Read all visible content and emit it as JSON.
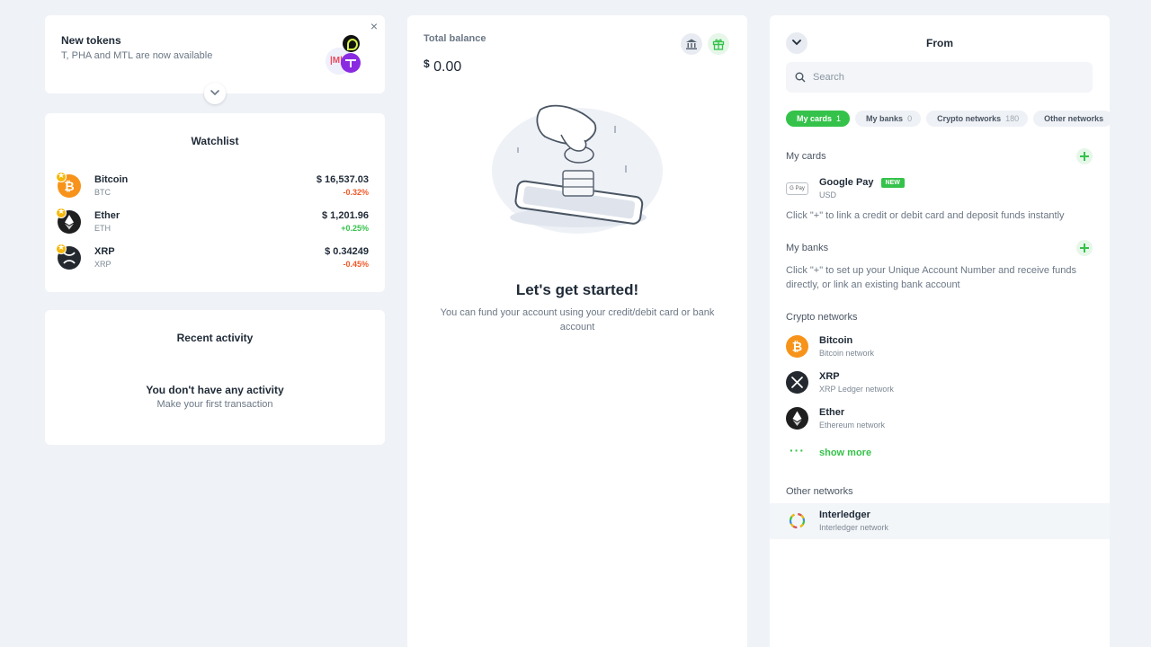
{
  "new_tokens": {
    "title": "New tokens",
    "subtitle": "T, PHA and MTL are now available",
    "close_glyph": "×",
    "mtl_mark": "|M|"
  },
  "watchlist": {
    "title": "Watchlist",
    "items": [
      {
        "name": "Bitcoin",
        "symbol": "BTC",
        "price": "$ 16,537.03",
        "change": "-0.32%",
        "direction": "down",
        "color": "#f7931a"
      },
      {
        "name": "Ether",
        "symbol": "ETH",
        "price": "$ 1,201.96",
        "change": "+0.25%",
        "direction": "up",
        "color": "#1f1f1f"
      },
      {
        "name": "XRP",
        "symbol": "XRP",
        "price": "$ 0.34249",
        "change": "-0.45%",
        "direction": "down",
        "color": "#23292f"
      }
    ]
  },
  "recent_activity": {
    "title": "Recent activity",
    "empty_title": "You don't have any activity",
    "empty_subtitle": "Make your first transaction"
  },
  "balance": {
    "label": "Total balance",
    "currency_symbol": "$",
    "amount": "0.00",
    "headline": "Let's get started!",
    "description": "You can fund your account using your credit/debit card or bank account"
  },
  "from_panel": {
    "title": "From",
    "search_placeholder": "Search",
    "chips": [
      {
        "label": "My cards",
        "count": "1",
        "active": true
      },
      {
        "label": "My banks",
        "count": "0",
        "active": false
      },
      {
        "label": "Crypto networks",
        "count": "180",
        "active": false
      },
      {
        "label": "Other networks",
        "count": "",
        "active": false
      }
    ],
    "my_cards": {
      "title": "My cards",
      "item": {
        "name": "Google Pay",
        "badge": "NEW",
        "sub": "USD",
        "logo_text": "G Pay"
      },
      "info": "Click \"+\" to link a credit or debit card and deposit funds instantly"
    },
    "my_banks": {
      "title": "My banks",
      "info": "Click \"+\" to set up your Unique Account Number and receive funds directly, or link an existing bank account"
    },
    "crypto_networks": {
      "title": "Crypto networks",
      "items": [
        {
          "name": "Bitcoin",
          "sub": "Bitcoin network"
        },
        {
          "name": "XRP",
          "sub": "XRP Ledger network"
        },
        {
          "name": "Ether",
          "sub": "Ethereum network"
        }
      ],
      "show_more": "show more"
    },
    "other_networks": {
      "title": "Other networks",
      "items": [
        {
          "name": "Interledger",
          "sub": "Interledger network"
        }
      ]
    }
  },
  "colors": {
    "accent_green": "#35c24a",
    "negative": "#f05a28",
    "background": "#eff2f7"
  }
}
